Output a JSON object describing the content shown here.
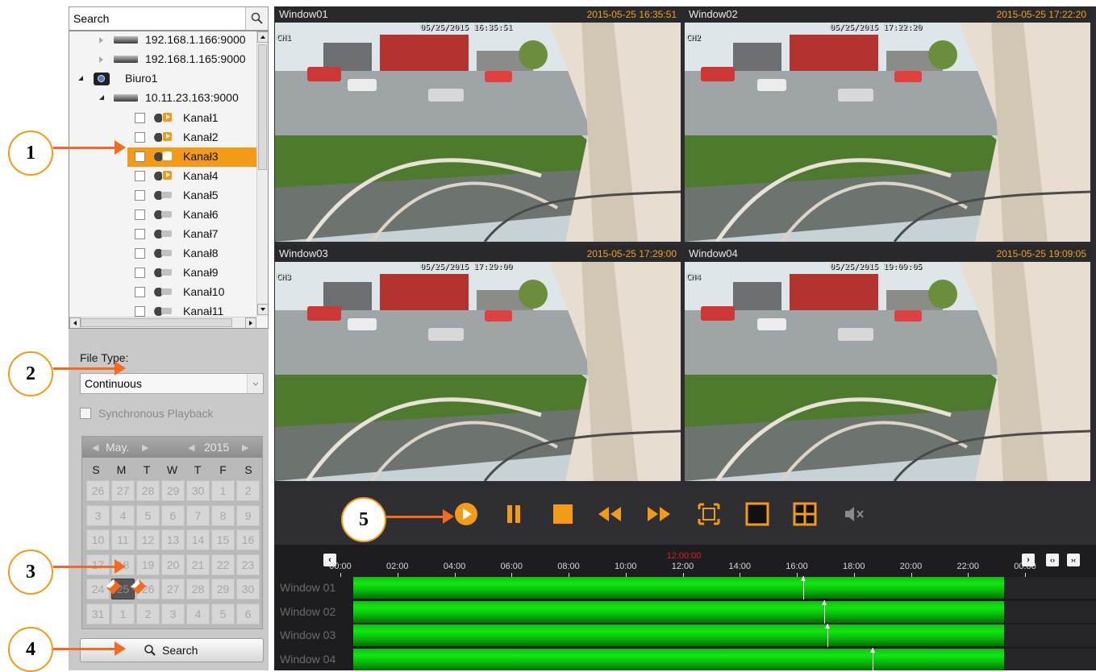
{
  "search": {
    "placeholder": "Search",
    "value": "Search"
  },
  "tree": {
    "items": [
      {
        "label": "192.168.1.166:9000",
        "type": "nvr"
      },
      {
        "label": "192.168.1.165:9000",
        "type": "nvr"
      },
      {
        "label": "Biuro1",
        "type": "group"
      },
      {
        "label": "10.11.23.163:9000",
        "type": "nvr"
      }
    ],
    "channels": [
      "Kanał1",
      "Kanał2",
      "Kanał3",
      "Kanał4",
      "Kanał5",
      "Kanał6",
      "Kanał7",
      "Kanał8",
      "Kanał9",
      "Kanał10",
      "Kanał11"
    ],
    "selected_channel": "Kanał3"
  },
  "file_type": {
    "label": "File Type:",
    "value": "Continuous"
  },
  "sync": {
    "label": "Synchronous Playback",
    "checked": false
  },
  "calendar": {
    "month": "May.",
    "year": "2015",
    "weekdays": [
      "S",
      "M",
      "T",
      "W",
      "T",
      "F",
      "S"
    ],
    "days": [
      "26",
      "27",
      "28",
      "29",
      "30",
      "1",
      "2",
      "3",
      "4",
      "5",
      "6",
      "7",
      "8",
      "9",
      "10",
      "11",
      "12",
      "13",
      "14",
      "15",
      "16",
      "17",
      "18",
      "19",
      "20",
      "21",
      "22",
      "23",
      "24",
      "25",
      "26",
      "27",
      "28",
      "29",
      "30",
      "31",
      "1",
      "2",
      "3",
      "4",
      "5",
      "6"
    ],
    "selected_day": "25",
    "record_days": [
      "25",
      "26"
    ]
  },
  "search_button": {
    "label": "Search"
  },
  "windows": [
    {
      "name": "Window01",
      "timestamp": "2015-05-25 16:35:51",
      "osd_time": "05/25/2015 16:35:51",
      "osd_ch": "CH1",
      "accent": "#f0a024"
    },
    {
      "name": "Window02",
      "timestamp": "2015-05-25 17:22:20",
      "osd_time": "05/25/2015 17:22:20",
      "osd_ch": "CH2",
      "accent": "#f0a024"
    },
    {
      "name": "Window03",
      "timestamp": "2015-05-25 17:29:00",
      "osd_time": "05/25/2015 17:29:00",
      "osd_ch": "CH3",
      "accent": "#f0a024"
    },
    {
      "name": "Window04",
      "timestamp": "2015-05-25 19:09:05",
      "osd_time": "05/25/2015 19:09:05",
      "osd_ch": "CH4",
      "accent": "#f0a024"
    }
  ],
  "controls": [
    "play-icon",
    "pause-icon",
    "stop-icon",
    "rewind-icon",
    "fast-forward-icon",
    "fullscreen-icon",
    "single-view-icon",
    "quad-view-icon",
    "mute-icon"
  ],
  "timeline": {
    "center_time": "12:00:00",
    "ticks": [
      "00:00",
      "02:00",
      "04:00",
      "06:00",
      "08:00",
      "10:00",
      "12:00",
      "14:00",
      "16:00",
      "18:00",
      "20:00",
      "22:00",
      "00:00"
    ],
    "tracks": [
      {
        "name": "Window 01",
        "record_start_hours": 0,
        "record_end_hours": 24,
        "playhead": "16:35:51",
        "playhead_hours": 16.6
      },
      {
        "name": "Window 02",
        "record_start_hours": 0,
        "record_end_hours": 24,
        "playhead": "17:22:20",
        "playhead_hours": 17.37
      },
      {
        "name": "Window 03",
        "record_start_hours": 0,
        "record_end_hours": 24,
        "playhead": "17:29:00",
        "playhead_hours": 17.48
      },
      {
        "name": "Window 04",
        "record_start_hours": 0,
        "record_end_hours": 24,
        "playhead": "19:09:05",
        "playhead_hours": 19.15
      }
    ]
  },
  "callouts": [
    "1",
    "2",
    "3",
    "4",
    "5"
  ],
  "colors": {
    "accent": "#f39a17",
    "callout_arrow": "#f26b21",
    "record_bar": "#0fe80f",
    "panel_bg": "#c9c9c9",
    "dark_bg": "#2c2c30"
  }
}
